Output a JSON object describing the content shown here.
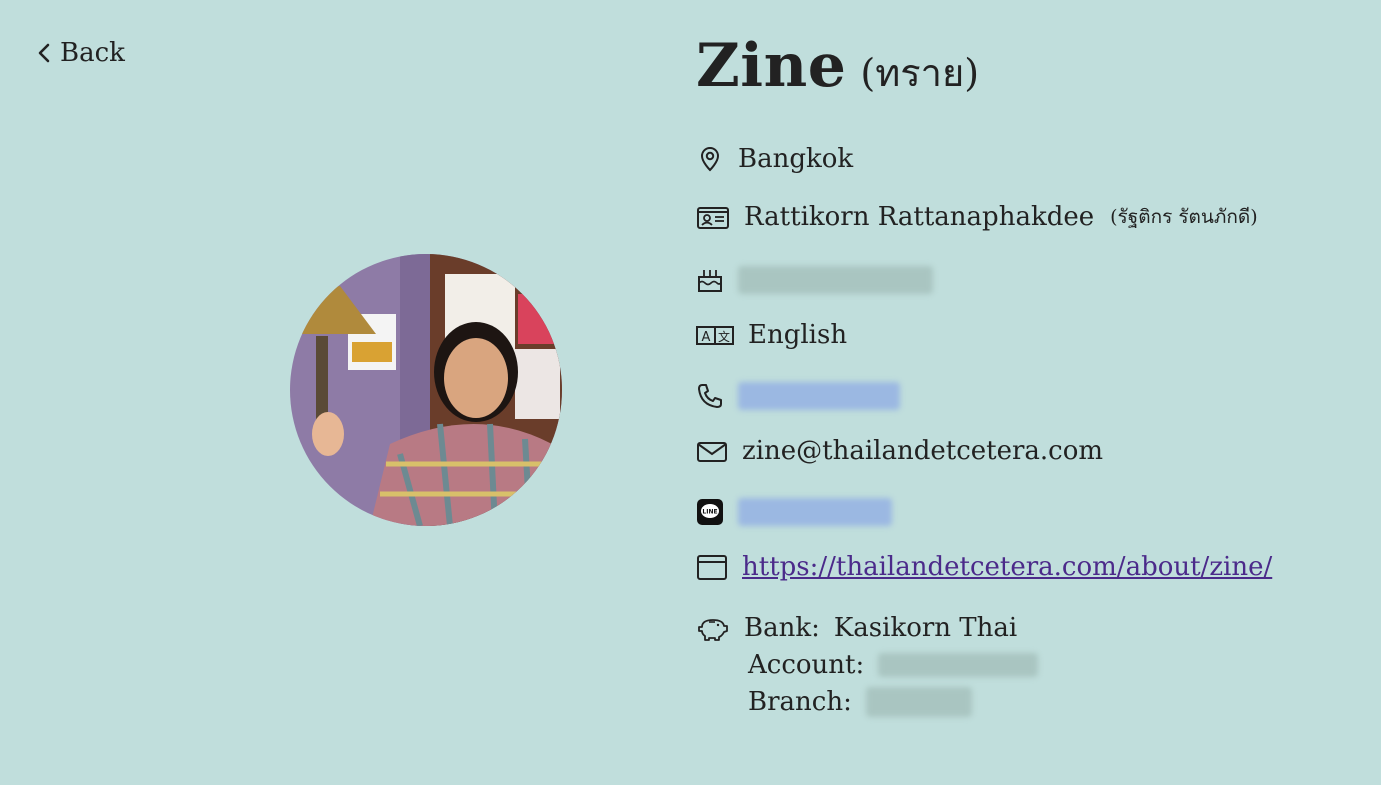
{
  "nav": {
    "back_label": "Back",
    "back_icon": "chevron-left-icon"
  },
  "profile": {
    "name": "Zine",
    "nickname": "(ทราย)",
    "location": "Bangkok",
    "full_name": "Rattikorn Rattanaphakdee",
    "full_name_thai": "(รัฐติกร รัตนภักดี)",
    "birthday": "",
    "language": "English",
    "phone": "",
    "email": "zine@thailandetcetera.com",
    "line_id": "",
    "website": "https://thailandetcetera.com/about/zine/",
    "bank": {
      "bank_label": "Bank:",
      "bank_name": "Kasikorn Thai",
      "account_label": "Account:",
      "account_value": "",
      "branch_label": "Branch:",
      "branch_value": ""
    }
  },
  "icons": {
    "location": "map-pin-icon",
    "name": "id-card-icon",
    "birthday": "birthday-cake-icon",
    "language": "language-icon",
    "phone": "phone-icon",
    "email": "envelope-icon",
    "line": "line-app-icon",
    "website": "browser-window-icon",
    "bank": "piggy-bank-icon"
  },
  "colors": {
    "background": "#c0dedc",
    "text": "#222222",
    "link": "#4b2a8a",
    "redacted_grey": "#a9c5c1",
    "redacted_blue": "#9bb8e2"
  }
}
